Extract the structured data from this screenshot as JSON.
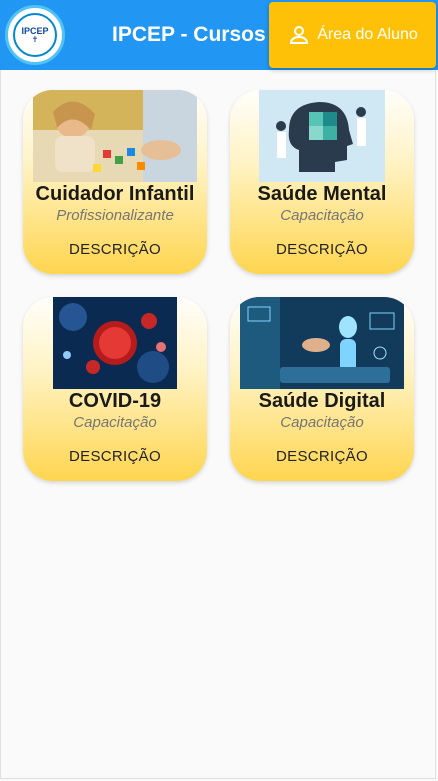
{
  "header": {
    "logo_text": "IPCEP",
    "title": "IPCEP - Cursos",
    "aluno_label": "Área do Aluno"
  },
  "courses": [
    {
      "title": "Cuidador Infantil",
      "subtitle": "Profissionalizante",
      "desc": "DESCRIÇÃO",
      "image": "child-playing-blocks"
    },
    {
      "title": "Saúde Mental",
      "subtitle": "Capacitação",
      "desc": "DESCRIÇÃO",
      "image": "head-puzzle-illustration"
    },
    {
      "title": "COVID-19",
      "subtitle": "Capacitação",
      "desc": "DESCRIÇÃO",
      "image": "virus-illustration"
    },
    {
      "title": "Saúde Digital",
      "subtitle": "Capacitação",
      "desc": "DESCRIÇÃO",
      "image": "digital-health-tablet"
    }
  ],
  "colors": {
    "header": "#2196f3",
    "button": "#ffc107",
    "card_bottom": "#ffd54f"
  }
}
